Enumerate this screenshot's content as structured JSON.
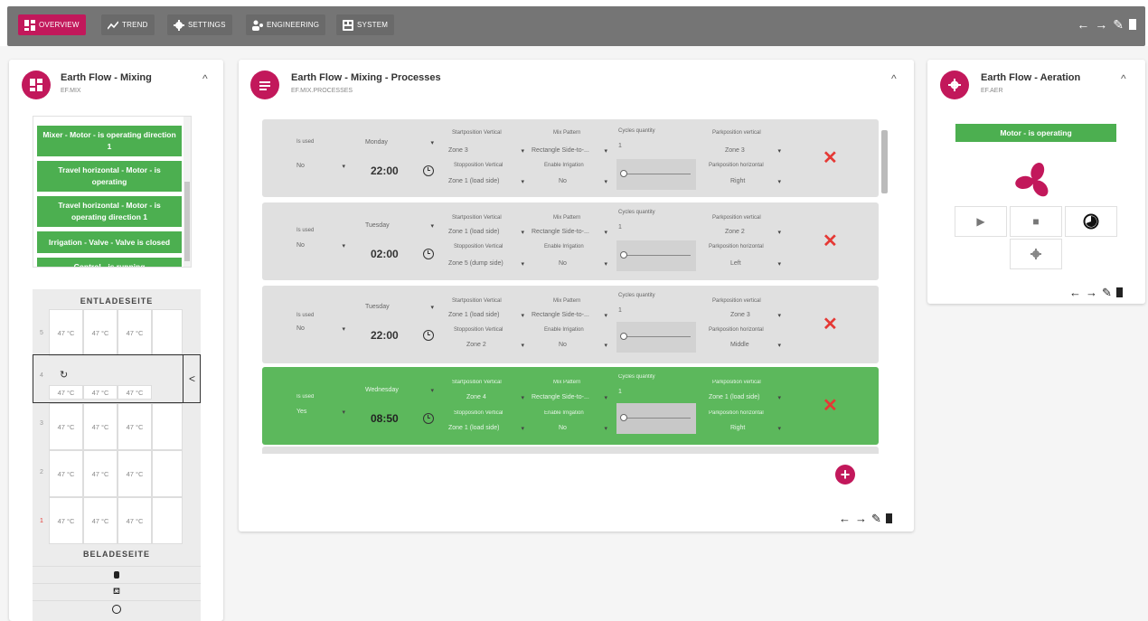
{
  "nav": {
    "items": [
      {
        "label": "OVERVIEW",
        "icon": "dashboard-icon",
        "active": true
      },
      {
        "label": "TREND",
        "icon": "trend-icon",
        "active": false
      },
      {
        "label": "SETTINGS",
        "icon": "gear-icon",
        "active": false
      },
      {
        "label": "ENGINEERING",
        "icon": "engineering-icon",
        "active": false
      },
      {
        "label": "SYSTEM",
        "icon": "system-icon",
        "active": false
      }
    ],
    "actions": {
      "back": "←",
      "forward": "→",
      "edit": "✎",
      "delete": "🗑"
    }
  },
  "mixing_card": {
    "title": "Earth Flow - Mixing",
    "subtitle": "EF.MIX",
    "status": [
      "Mixer - Motor - is operating direction 1",
      "Travel horizontal - Motor - is operating",
      "Travel horizontal - Motor - is operating direction 1",
      "Irrigation - Valve - Valve is closed",
      "Control - is running"
    ],
    "top_label": "ENTLADESEITE",
    "bottom_label": "BELADESEITE",
    "rows": [
      {
        "num": "5",
        "cells": [
          "47 °C",
          "47 °C",
          "47 °C"
        ]
      },
      {
        "num": "4",
        "cells": [
          "47 °C",
          "47 °C",
          "47 °C"
        ]
      },
      {
        "num": "3",
        "cells": [
          "47 °C",
          "47 °C",
          "47 °C"
        ]
      },
      {
        "num": "2",
        "cells": [
          "47 °C",
          "47 °C",
          "47 °C"
        ]
      },
      {
        "num": "1",
        "cells": [
          "47 °C",
          "47 °C",
          "47 °C"
        ]
      }
    ],
    "collapse": "^",
    "chevron": "<"
  },
  "processes_card": {
    "title": "Earth Flow - Mixing - Processes",
    "subtitle": "EF.MIX.PROCESSES",
    "collapse": "^",
    "labels": {
      "is_used": "Is used",
      "start_vertical": "Startposition Vertical",
      "stop_vertical": "Stopposition Vertical",
      "mix_pattern": "Mix Pattern",
      "enable_irrigation": "Enable Irrigation",
      "cycles_quantity": "Cycles quantity",
      "park_vertical": "Parkposition vertical",
      "park_horizontal": "Parkposition horizontal"
    },
    "rows": [
      {
        "used": "No",
        "day": "Monday",
        "time": "22:00",
        "start": "Zone 3",
        "stop": "Zone 1 (load side)",
        "pattern": "Rectangle Side-to-...",
        "irrigation": "No",
        "cycles": "1",
        "park_v": "Zone 3",
        "park_h": "Right",
        "active": false
      },
      {
        "used": "No",
        "day": "Tuesday",
        "time": "02:00",
        "start": "Zone 1 (load side)",
        "stop": "Zone 5 (dump side)",
        "pattern": "Rectangle Side-to-...",
        "irrigation": "No",
        "cycles": "1",
        "park_v": "Zone 2",
        "park_h": "Left",
        "active": false
      },
      {
        "used": "No",
        "day": "Tuesday",
        "time": "22:00",
        "start": "Zone 1 (load side)",
        "stop": "Zone 2",
        "pattern": "Rectangle Side-to-...",
        "irrigation": "No",
        "cycles": "1",
        "park_v": "Zone 3",
        "park_h": "Middle",
        "active": false
      },
      {
        "used": "Yes",
        "day": "Wednesday",
        "time": "08:50",
        "start": "Zone 4",
        "stop": "Zone 1 (load side)",
        "pattern": "Rectangle Side-to-...",
        "irrigation": "No",
        "cycles": "1",
        "park_v": "Zone 1 (load side)",
        "park_h": "Right",
        "active": true
      }
    ]
  },
  "aeration_card": {
    "title": "Earth Flow - Aeration",
    "subtitle": "EF.AER",
    "collapse": "^",
    "status": "Motor - is operating"
  },
  "colors": {
    "accent": "#c2185b",
    "status_green": "#4caf50",
    "active_row": "#5cb85c",
    "delete_red": "#e53935"
  }
}
